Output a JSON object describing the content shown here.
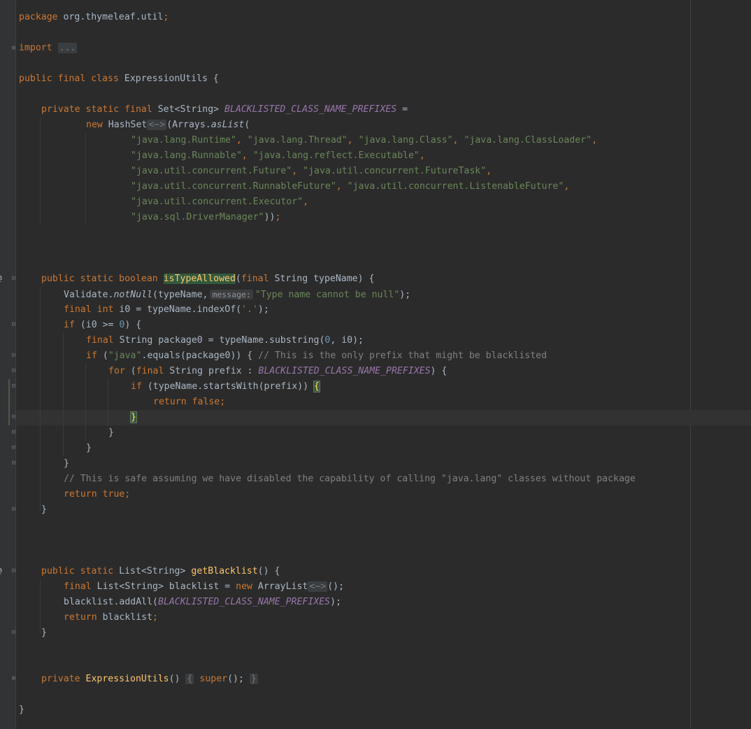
{
  "editor": {
    "package_kw": "package",
    "package_name": " org.thymeleaf.util",
    "import_kw": "import",
    "import_fold": "...",
    "class_decl": {
      "mods": "public final class",
      "name": "ExpressionUtils",
      "open": " {"
    },
    "field": {
      "mods": "private static final",
      "type": " Set<String> ",
      "name": "BLACKLISTED_CLASS_NAME_PREFIXES",
      "eq": " =",
      "new_kw": "new",
      "ctor": " HashSet",
      "diamond": "<~>",
      "call_open": "(Arrays.",
      "aslist": "asList",
      "paren": "("
    },
    "strings": [
      [
        "\"java.lang.Runtime\"",
        "\"java.lang.Thread\"",
        "\"java.lang.Class\"",
        "\"java.lang.ClassLoader\""
      ],
      [
        "\"java.lang.Runnable\"",
        "\"java.lang.reflect.Executable\""
      ],
      [
        "\"java.util.concurrent.Future\"",
        "\"java.util.concurrent.FutureTask\""
      ],
      [
        "\"java.util.concurrent.RunnableFuture\"",
        "\"java.util.concurrent.ListenableFuture\""
      ],
      [
        "\"java.util.concurrent.Executor\""
      ],
      [
        "\"java.sql.DriverManager\""
      ]
    ],
    "method1": {
      "mods": "public static boolean",
      "name": "isTypeAllowed",
      "params_kw": "final",
      "params": " String typeName) {",
      "validate": "Validate.",
      "notnull": "notNull",
      "validate_arg": "(typeName,",
      "hint": "message:",
      "validate_msg": "\"Type name cannot be null\"",
      "validate_end": ");",
      "decl_kw": "final int",
      "decl_rest": " i0 = typeName.indexOf(",
      "decl_char": "'.'",
      "decl_end": ");",
      "if_kw": "if",
      "if_cond": " (i0 >= ",
      "if_zero": "0",
      "if_end": ") {",
      "pkg_kw": "final",
      "pkg_rest": " String package0 = typeName.substring(",
      "pkg_zero": "0",
      "pkg_tail": ", i0);",
      "if2_kw": "if",
      "if2_open": " (",
      "if2_str": "\"java\"",
      "if2_rest": ".equals(package0)) { ",
      "if2_cmt": "// This is the only prefix that might be blacklisted",
      "for_kw": "for",
      "for_open": " (",
      "for_final": "final",
      "for_rest": " String prefix : ",
      "for_const": "BLACKLISTED_CLASS_NAME_PREFIXES",
      "for_end": ") {",
      "if3_kw": "if",
      "if3_rest": " (typeName.startsWith(prefix)) ",
      "if3_brace": "{",
      "ret_false": "return false",
      "semi": ";",
      "close_hl": "}",
      "close": "}",
      "cmt_safe": "// This is safe assuming we have disabled the capability of calling \"java.lang\" classes without package",
      "ret_true": "return true"
    },
    "method2": {
      "mods": "public static",
      "type": " List<String> ",
      "name": "getBlacklist",
      "params": "() {",
      "l1_kw": "final",
      "l1_a": " List<String> blacklist = ",
      "l1_new": "new",
      "l1_b": " ArrayList",
      "l1_diamond": "<~>",
      "l1_end": "();",
      "l2_a": "blacklist.addAll(",
      "l2_const": "BLACKLISTED_CLASS_NAME_PREFIXES",
      "l2_end": ");",
      "l3_kw": "return",
      "l3_rest": " blacklist",
      "close": "}"
    },
    "ctor": {
      "mods": "private",
      "name": "ExpressionUtils",
      "parens": "()",
      "body_open": "{",
      "super_kw": "super",
      "super_rest": "();",
      "body_close": "}"
    },
    "class_close": "}"
  }
}
